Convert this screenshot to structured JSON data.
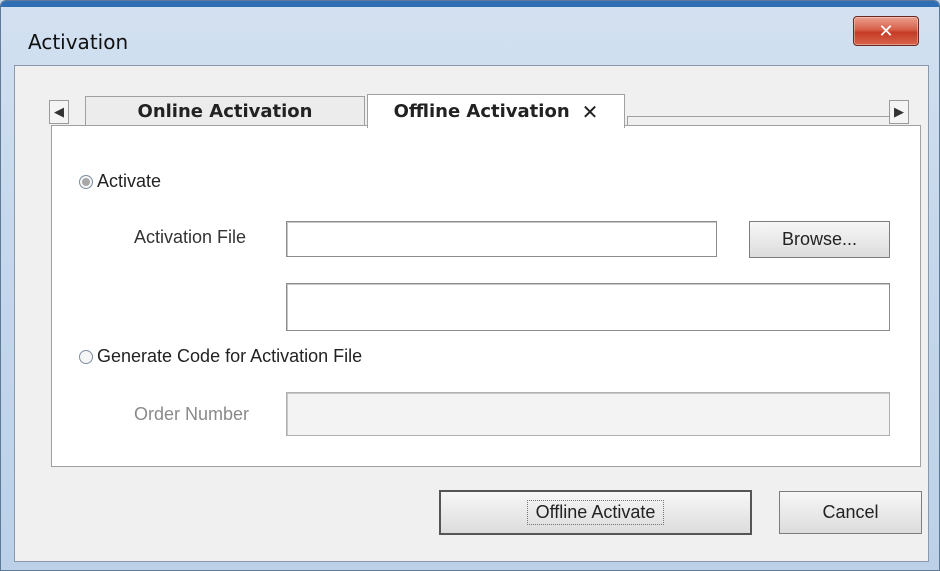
{
  "window": {
    "title": "Activation",
    "close_glyph": "✕"
  },
  "tabs": {
    "scroll_left_glyph": "◀",
    "scroll_right_glyph": "▶",
    "items": [
      {
        "label": "Online Activation",
        "active": false
      },
      {
        "label": "Offline Activation",
        "active": true,
        "close_glyph": "✕"
      }
    ]
  },
  "form": {
    "option_activate": {
      "label": "Activate",
      "selected": true
    },
    "activation_file": {
      "label": "Activation File",
      "value": "",
      "status_value": ""
    },
    "browse_label": "Browse...",
    "option_generate": {
      "label": "Generate Code for Activation File",
      "selected": false
    },
    "order_number": {
      "label": "Order Number",
      "value": ""
    }
  },
  "footer": {
    "offline_activate_label": "Offline Activate",
    "cancel_label": "Cancel"
  },
  "colors": {
    "title_bar_accent": "#2f6db4",
    "close_button": "#d1503a"
  }
}
